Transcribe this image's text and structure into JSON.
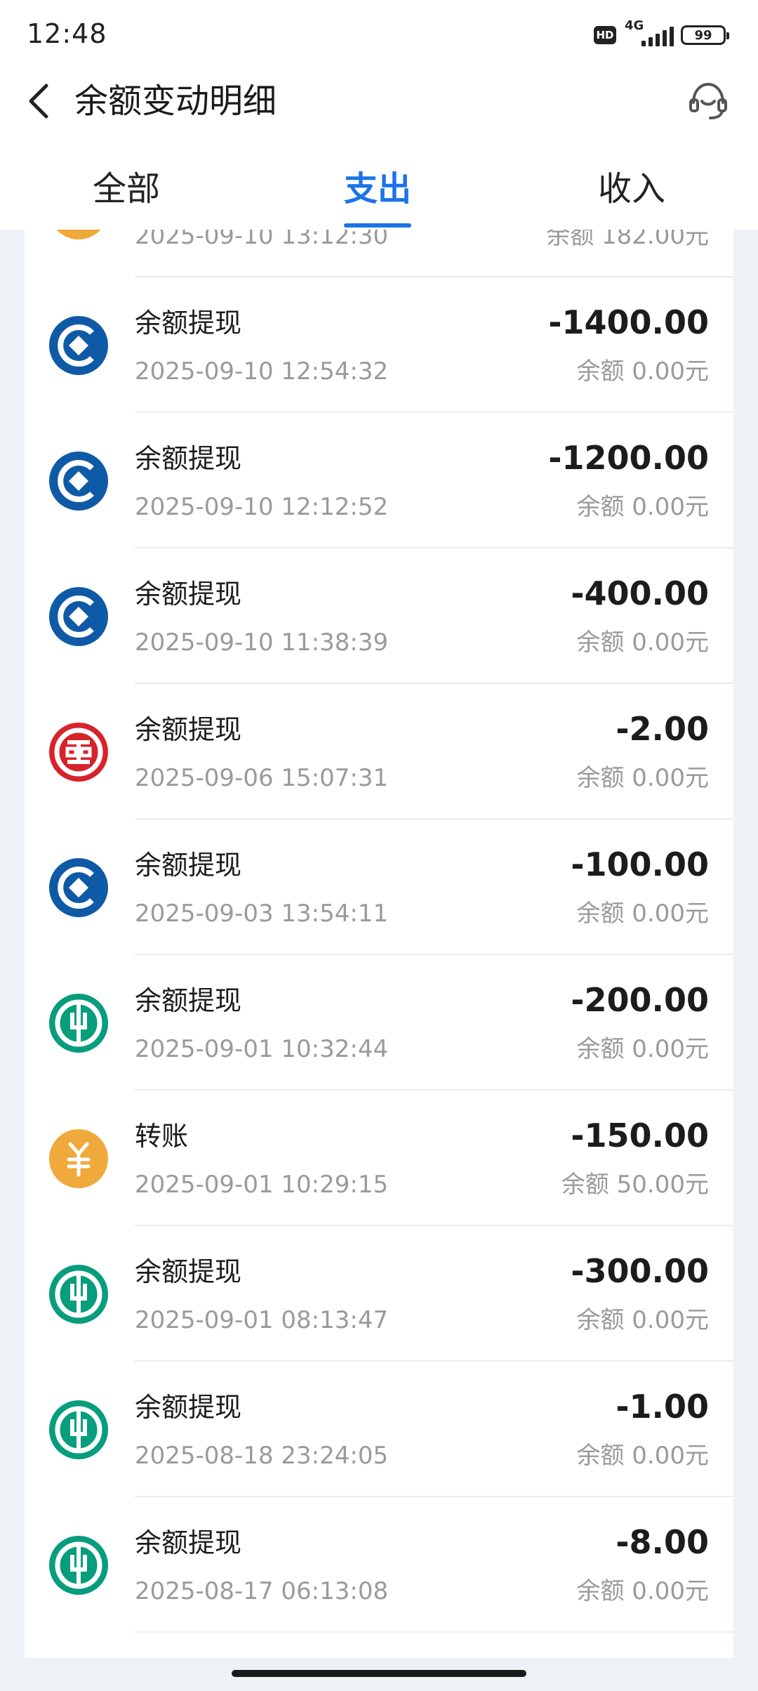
{
  "status_bar": {
    "time": "12:48",
    "hd": "HD",
    "network": "4G",
    "battery": "99"
  },
  "header": {
    "title": "余额变动明细",
    "back_icon": "chevron-left-icon",
    "service_icon": "headset-icon"
  },
  "tabs": [
    {
      "label": "全部",
      "active": false
    },
    {
      "label": "支出",
      "active": true
    },
    {
      "label": "收入",
      "active": false
    }
  ],
  "partial_row": {
    "time": "2025-09-10 13:12:30",
    "balance": "余额 182.00元"
  },
  "transactions": [
    {
      "title": "余额提现",
      "time": "2025-09-10 12:54:32",
      "amount": "-1400.00",
      "balance": "余额 0.00元",
      "icon": "ccb-bank-icon"
    },
    {
      "title": "余额提现",
      "time": "2025-09-10 12:12:52",
      "amount": "-1200.00",
      "balance": "余额 0.00元",
      "icon": "ccb-bank-icon"
    },
    {
      "title": "余额提现",
      "time": "2025-09-10 11:38:39",
      "amount": "-400.00",
      "balance": "余额 0.00元",
      "icon": "ccb-bank-icon"
    },
    {
      "title": "余额提现",
      "time": "2025-09-06 15:07:31",
      "amount": "-2.00",
      "balance": "余额 0.00元",
      "icon": "icbc-bank-icon"
    },
    {
      "title": "余额提现",
      "time": "2025-09-03 13:54:11",
      "amount": "-100.00",
      "balance": "余额 0.00元",
      "icon": "ccb-bank-icon"
    },
    {
      "title": "余额提现",
      "time": "2025-09-01 10:32:44",
      "amount": "-200.00",
      "balance": "余额 0.00元",
      "icon": "abc-bank-icon"
    },
    {
      "title": "转账",
      "time": "2025-09-01 10:29:15",
      "amount": "-150.00",
      "balance": "余额 50.00元",
      "icon": "transfer-yuan-icon"
    },
    {
      "title": "余额提现",
      "time": "2025-09-01 08:13:47",
      "amount": "-300.00",
      "balance": "余额 0.00元",
      "icon": "abc-bank-icon"
    },
    {
      "title": "余额提现",
      "time": "2025-08-18 23:24:05",
      "amount": "-1.00",
      "balance": "余额 0.00元",
      "icon": "abc-bank-icon"
    },
    {
      "title": "余额提现",
      "time": "2025-08-17 06:13:08",
      "amount": "-8.00",
      "balance": "余额 0.00元",
      "icon": "abc-bank-icon"
    }
  ],
  "colors": {
    "accent": "#1a73e8",
    "ccb": "#0f5aa6",
    "icbc": "#d8232a",
    "abc": "#079d7d",
    "transfer": "#f0a93b"
  }
}
